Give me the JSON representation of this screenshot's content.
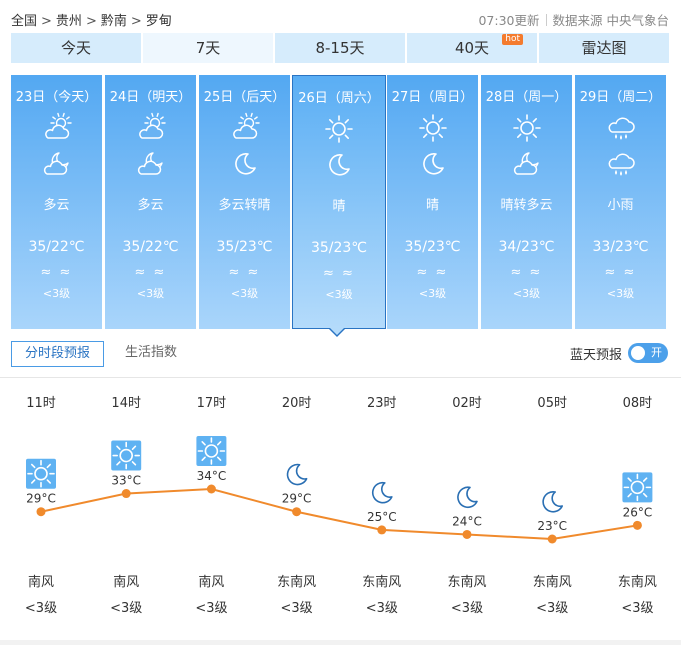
{
  "breadcrumb": {
    "items": [
      "全国",
      "贵州",
      "黔南",
      "罗甸"
    ],
    "sep": ">"
  },
  "update": {
    "time": "07:30更新",
    "source": "数据来源 中央气象台"
  },
  "tabs": [
    {
      "label": "今天"
    },
    {
      "label": "7天"
    },
    {
      "label": "8-15天"
    },
    {
      "label": "40天",
      "badge": "hot"
    },
    {
      "label": "雷达图"
    }
  ],
  "days": [
    {
      "date": "23日（今天）",
      "icon_day": "partly-cloudy-sun-icon",
      "icon_night": "cloudy-moon-icon",
      "desc": "多云",
      "temp": "35/22℃",
      "wave": "≈ ≈",
      "wind": "<3级"
    },
    {
      "date": "24日（明天）",
      "icon_day": "partly-cloudy-sun-icon",
      "icon_night": "cloudy-moon-icon",
      "desc": "多云",
      "temp": "35/22℃",
      "wave": "≈ ≈",
      "wind": "<3级"
    },
    {
      "date": "25日（后天）",
      "icon_day": "partly-cloudy-sun-icon",
      "icon_night": "moon-icon",
      "desc": "多云转晴",
      "temp": "35/23℃",
      "wave": "≈ ≈",
      "wind": "<3级"
    },
    {
      "date": "26日（周六）",
      "icon_day": "sun-icon",
      "icon_night": "moon-icon",
      "desc": "晴",
      "temp": "35/23℃",
      "wave": "≈ ≈",
      "wind": "<3级"
    },
    {
      "date": "27日（周日）",
      "icon_day": "sun-icon",
      "icon_night": "moon-icon",
      "desc": "晴",
      "temp": "35/23℃",
      "wave": "≈ ≈",
      "wind": "<3级"
    },
    {
      "date": "28日（周一）",
      "icon_day": "sun-icon",
      "icon_night": "cloudy-moon-icon",
      "desc": "晴转多云",
      "temp": "34/23℃",
      "wave": "≈ ≈",
      "wind": "<3级"
    },
    {
      "date": "29日（周二）",
      "icon_day": "rain-cloud-icon",
      "icon_night": "rain-cloud-icon",
      "desc": "小雨",
      "temp": "33/23℃",
      "wave": "≈ ≈",
      "wind": "<3级"
    }
  ],
  "subtabs": {
    "active": "分时段预报",
    "other": "生活指数"
  },
  "toggle": {
    "label": "蓝天预报",
    "state": "开"
  },
  "hourly": {
    "line_color": "#f08a2c",
    "points": [
      {
        "time": "11时",
        "icon": "sun-icon",
        "temp": "29°C",
        "value": 29,
        "wind_dir": "南风",
        "wind_level": "<3级"
      },
      {
        "time": "14时",
        "icon": "sun-icon",
        "temp": "33°C",
        "value": 33,
        "wind_dir": "南风",
        "wind_level": "<3级"
      },
      {
        "time": "17时",
        "icon": "sun-icon",
        "temp": "34°C",
        "value": 34,
        "wind_dir": "南风",
        "wind_level": "<3级"
      },
      {
        "time": "20时",
        "icon": "moon-icon",
        "temp": "29°C",
        "value": 29,
        "wind_dir": "东南风",
        "wind_level": "<3级"
      },
      {
        "time": "23时",
        "icon": "moon-icon",
        "temp": "25°C",
        "value": 25,
        "wind_dir": "东南风",
        "wind_level": "<3级"
      },
      {
        "time": "02时",
        "icon": "moon-icon",
        "temp": "24°C",
        "value": 24,
        "wind_dir": "东南风",
        "wind_level": "<3级"
      },
      {
        "time": "05时",
        "icon": "moon-icon",
        "temp": "23°C",
        "value": 23,
        "wind_dir": "东南风",
        "wind_level": "<3级"
      },
      {
        "time": "08时",
        "icon": "sun-icon",
        "temp": "26°C",
        "value": 26,
        "wind_dir": "东南风",
        "wind_level": "<3级"
      }
    ]
  }
}
